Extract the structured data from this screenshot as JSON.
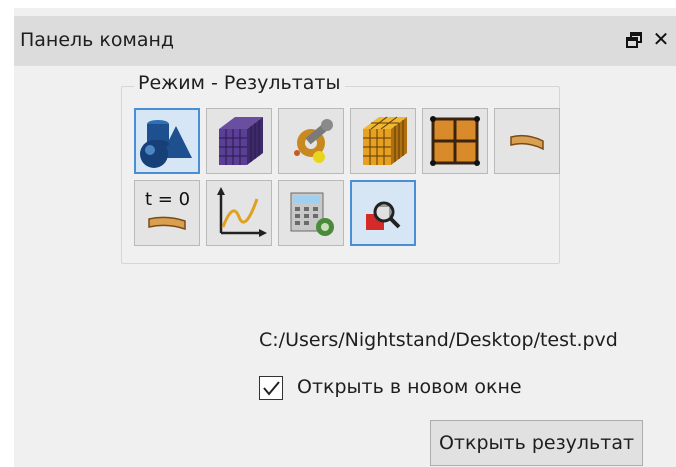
{
  "panel": {
    "title": "Панель команд",
    "float_icon": "float-window-icon",
    "close_icon": "close-icon",
    "close_glyph": "✕"
  },
  "group": {
    "title": "Режим - Результаты",
    "buttons": [
      {
        "name": "geometry-shapes",
        "icon": "shapes-icon",
        "selected": true
      },
      {
        "name": "mesh-cube",
        "icon": "mesh-cube-icon",
        "selected": false
      },
      {
        "name": "settings-tools",
        "icon": "wrench-icon",
        "selected": false
      },
      {
        "name": "orange-mesh-cube",
        "icon": "orange-cube-icon",
        "selected": false
      },
      {
        "name": "grid-plane",
        "icon": "grid-icon",
        "selected": false
      },
      {
        "name": "deformation",
        "icon": "plank-icon",
        "selected": false
      },
      {
        "name": "time-zero",
        "icon": "t0-icon",
        "label": "t = 0",
        "selected": false
      },
      {
        "name": "graph",
        "icon": "graph-icon",
        "selected": false
      },
      {
        "name": "calculator",
        "icon": "calculator-gear-icon",
        "selected": false
      },
      {
        "name": "results-view",
        "icon": "magnifier-icon",
        "selected": true
      }
    ]
  },
  "file_path": "C:/Users/Nightstand/Desktop/test.pvd",
  "open_new_window": {
    "label": "Открыть в новом окне",
    "checked": true
  },
  "open_button": {
    "label": "Открыть результат"
  },
  "colors": {
    "selected_border": "#4a8fd6",
    "panel_bg": "#f0f0f0",
    "title_bg": "#dcdcdc"
  }
}
